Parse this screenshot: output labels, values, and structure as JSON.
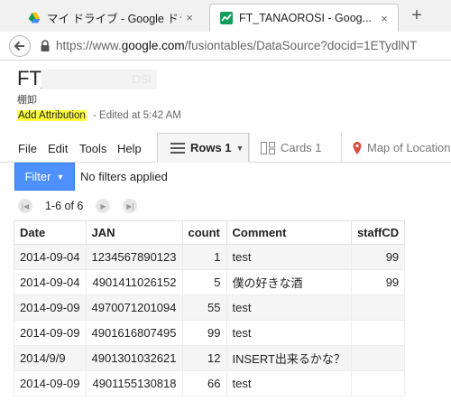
{
  "browser": {
    "tabs": [
      {
        "title": "マイ ドライブ - Google ドライブ",
        "close": "×"
      },
      {
        "title": "FT_TANAOROSI - Goog...",
        "close": "×"
      }
    ],
    "new_tab": "+",
    "url_prefix": "https://www.",
    "url_domain": "google.com",
    "url_rest": "/fusiontables/DataSource?docid=1ETydlNT"
  },
  "header": {
    "title": "FT_",
    "title_obscured": "DSI",
    "subtitle": "棚卸",
    "attribution_label": "Add Attribution",
    "edited": "-   Edited at 5:42 AM"
  },
  "menu": {
    "items": [
      "File",
      "Edit",
      "Tools",
      "Help"
    ]
  },
  "view_tabs": [
    {
      "label": "Rows 1",
      "icon": "rows-icon"
    },
    {
      "label": "Cards 1",
      "icon": "cards-icon"
    },
    {
      "label": "Map of Location",
      "icon": "map-pin-icon"
    }
  ],
  "filter": {
    "button_label": "Filter",
    "status": "No filters applied"
  },
  "pager": {
    "range": "1-6 of 6"
  },
  "table": {
    "columns": [
      "Date",
      "JAN",
      "count",
      "Comment",
      "staffCD"
    ],
    "rows": [
      [
        "2014-09-04",
        "1234567890123",
        "1",
        "test",
        "99"
      ],
      [
        "2014-09-04",
        "4901411026152",
        "5",
        "僕の好きな酒",
        "99"
      ],
      [
        "2014-09-09",
        "4970071201094",
        "55",
        "test",
        ""
      ],
      [
        "2014-09-09",
        "4901616807495",
        "99",
        "test",
        ""
      ],
      [
        "2014/9/9",
        "4901301032621",
        "12",
        "INSERT出来るかな？",
        ""
      ],
      [
        "2014-09-09",
        "4901155130818",
        "66",
        "test",
        ""
      ]
    ]
  },
  "colors": {
    "filter_button": "#4d90fe",
    "attribution_highlight": "#ffff3c",
    "sheets_icon": "#0f9d58"
  }
}
